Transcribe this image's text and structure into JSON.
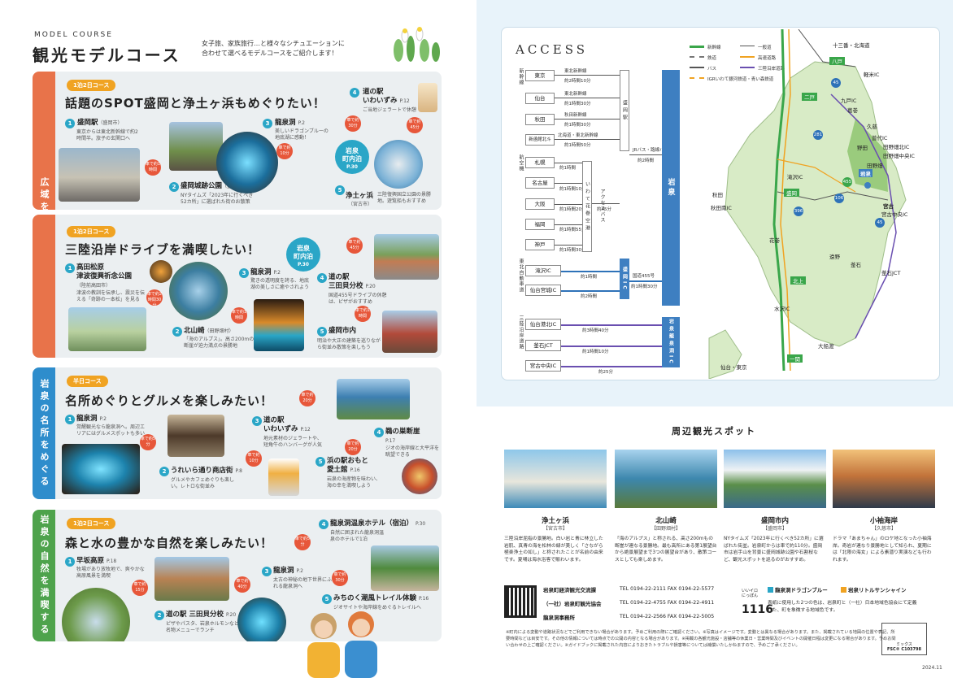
{
  "left": {
    "label": "MODEL COURSE",
    "title": "観光モデルコース",
    "subtitle_1": "女子旅、家族旅行…と様々なシチュエーションに",
    "subtitle_2": "合わせて選べるモデルコースをご紹介します！",
    "sections": [
      {
        "side": "広域をめぐる",
        "tag": "1泊2日コース",
        "heading": "話題のSPOT盛岡と浄土ヶ浜もめぐりたい！",
        "color": "#e8734a",
        "spots": [
          {
            "num": "1",
            "name": "盛岡駅",
            "sub": "（盛岡市）",
            "desc": "東京からは東北新幹線で約2時間半。旅子の玄関口へ"
          },
          {
            "num": "2",
            "name": "盛岡城跡公園",
            "sub": "（盛岡市）",
            "desc": "NYタイムズ「2023年に行くべき52カ所」に選ばれた街のお散策"
          },
          {
            "num": "3",
            "name": "龍泉洞",
            "pg": "P.2",
            "desc": "美しいドラゴンブルーの地底湖に感動！"
          },
          {
            "num": "4",
            "name": "道の駅",
            "name2": "いわいずみ",
            "pg": "P.12",
            "desc": "ご当地ジェラートで休憩"
          },
          {
            "num": "5",
            "name": "浄土ヶ浜",
            "sub": "（宮古市）",
            "desc": "三陸復興国立公園の景勝地。遊覧船もおすすめ"
          }
        ],
        "cars": [
          "車で約1時間",
          "車で約10分",
          "車で約30分",
          "車で約45分",
          "車で約1時間"
        ],
        "stay": [
          "岩泉",
          "町内泊",
          "P.30"
        ]
      },
      {
        "side": "",
        "tag": "1泊2日コース",
        "heading": "三陸沿岸ドライブを満喫したい！",
        "color": "#e8734a",
        "spots": [
          {
            "num": "1",
            "name": "高田松原",
            "name2": "津波復興祈念公園",
            "sub": "（陸前高田市）",
            "desc": "津波の教訓を伝承し、震災を伝える「奇跡の一本松」を見る"
          },
          {
            "num": "2",
            "name": "北山崎",
            "sub": "（田野畑村）",
            "desc": "「海のアルプス」。高さ200mの断崖が迫力満点の景勝地"
          },
          {
            "num": "3",
            "name": "龍泉洞",
            "pg": "P.2",
            "desc": "驚きの透明度を誇る、地底湖の美しさに癒やされよう"
          },
          {
            "num": "4",
            "name": "道の駅",
            "name2": "三田貝分校",
            "pg": "P.20",
            "desc": "国道455号ドライブの休憩は、ピザがおすすめ"
          },
          {
            "num": "5",
            "name": "盛岡市内",
            "desc": "明治や大正の建築を巡りながら街並み散策を楽しもう"
          }
        ],
        "cars": [
          "車で約2時間30分",
          "車で約1時間",
          "車で約45分",
          "車で約1時間"
        ],
        "stay": [
          "岩泉",
          "町内泊",
          "P.30"
        ]
      },
      {
        "side": "岩泉の名所をめぐる",
        "tag": "半日コース",
        "heading": "名所めぐりとグルメを楽しみたい！",
        "color": "#2e8dcc",
        "spots": [
          {
            "num": "1",
            "name": "龍泉洞",
            "pg": "P.2",
            "desc": "覚醒観光なら龍泉洞へ。周辺エリアにはグルメスポットも多い"
          },
          {
            "num": "2",
            "name": "うれいら通り商店街",
            "pg": "P.8",
            "desc": "グルメやカフェめぐりも楽しい。レトロな街並み"
          },
          {
            "num": "3",
            "name": "道の駅",
            "name2": "いわいずみ",
            "pg": "P.12",
            "desc": "地元素材のジェラートや、短角牛のハンバーグが人気"
          },
          {
            "num": "4",
            "name": "鵜の巣断崖",
            "pg": "P.17",
            "desc": "ジオの海岸線と大平洋を眺望できる"
          },
          {
            "num": "5",
            "name": "浜の駅おもと",
            "name2": "愛土館",
            "pg": "P.16",
            "desc": "岩泉の海産物を味わい、海の幸を満喫しよう"
          }
        ],
        "cars": [
          "車で約5分",
          "車で約10分",
          "車で約20分",
          "車で約20分"
        ]
      },
      {
        "side": "岩泉の自然を満喫する",
        "tag": "1泊2日コース",
        "heading": "森と水の豊かな自然を楽しみたい！",
        "color": "#4ea34c",
        "spots": [
          {
            "num": "1",
            "name": "早坂高原",
            "pg": "P.18",
            "desc": "牧場があり放牧地で、爽やかな高原風景を満喫"
          },
          {
            "num": "2",
            "name": "道の駅 三田貝分校",
            "pg": "P.20",
            "desc": "ピザやパスタ、岩泉ホルモンなどの名物メニューでランチ"
          },
          {
            "num": "3",
            "name": "龍泉洞",
            "pg": "P.2",
            "desc": "太古の神秘の地下世界にふれる龍泉洞へ"
          },
          {
            "num": "4",
            "name": "龍泉洞温泉ホテル（宿泊）",
            "pg": "P.30",
            "desc": "自然に囲まれた龍泉洞温泉のホテルで1泊"
          },
          {
            "num": "5",
            "name": "みちのく潮風トレイル体験",
            "pg": "P.16",
            "desc": "ジオサイトや海岸線をめぐるトレイルへ"
          }
        ],
        "cars": [
          "車で約15分",
          "車で約40分",
          "車で約5分",
          "車で約30分"
        ]
      }
    ]
  },
  "right": {
    "access_title": "ACCESS",
    "legend": [
      "新幹線",
      "鉄道",
      "バス",
      "一般道",
      "高速道路",
      "三陸沿岸道路",
      "IGRいわて銀河鉄道・青い森鉄道",
      "三陸鉄道リアス線"
    ],
    "rail_label": "新幹線",
    "air_label": "航空機",
    "exp_label": "東北自動車道",
    "sanriku_label": "三陸沿岸道路",
    "shinkansen": [
      {
        "st": "東京",
        "line": "東北新幹線",
        "time": "約2時間10分"
      },
      {
        "st": "仙台",
        "line": "東北新幹線",
        "time": "約1時間30分"
      },
      {
        "st": "秋田",
        "line": "秋田新幹線",
        "time": "約1時間30分"
      },
      {
        "st": "新函館北斗",
        "line": "北海道・東北新幹線",
        "time": "約1時間50分"
      }
    ],
    "morioka_station": "盛岡駅",
    "bus_label": "JRバス・路線バス",
    "bus_time": "約2時間",
    "air": [
      {
        "st": "札幌",
        "time": "約1時間"
      },
      {
        "st": "名古屋",
        "time": "約1時間10分"
      },
      {
        "st": "大阪",
        "time": "約1時間20分"
      },
      {
        "st": "福岡",
        "time": "約1時間55分"
      },
      {
        "st": "神戸",
        "time": "約1時間30分"
      }
    ],
    "hanamaki": "いわて花巻空港",
    "access_bus": "アクセスバス",
    "access_time": "約45分",
    "iwaizumi": "岩泉",
    "ic": [
      {
        "st": "滝沢IC",
        "time": "約1時間"
      },
      {
        "st": "仙台宮城IC",
        "time": "約2時間"
      }
    ],
    "morioka_ic": "盛岡IC",
    "route455": "国道455号",
    "time455": "約1時間30分",
    "sanriku": [
      {
        "st": "仙台港北IC",
        "time": "約3時間40分"
      },
      {
        "st": "釜石JCT",
        "time": "約1時間10分"
      },
      {
        "st": "宮古中央IC",
        "time": "約25分"
      }
    ],
    "iwaizumi_ryusen": "岩泉龍泉洞IC",
    "map_labels": [
      "十三番・北海道",
      "八戸",
      "一戸",
      "二戸",
      "軽米IC",
      "九戸IC",
      "葛巻",
      "久慈",
      "普代IC",
      "田野畑北IC",
      "田野畑中央IC",
      "野田",
      "宮古",
      "盛岡",
      "花巻",
      "北上",
      "水沢IC",
      "一関",
      "大船渡",
      "釜石",
      "遠野",
      "陸中野田",
      "岩泉",
      "滝沢IC",
      "秋田",
      "秋田南IC",
      "大館",
      "田野畑",
      "小本",
      "宮古中央IC",
      "釜石JCT",
      "仙台・東京"
    ],
    "ichinoseki": "至仙台・東京",
    "nearby_title": "周辺観光スポット",
    "nearby": [
      {
        "name": "浄土ヶ浜",
        "area": "【宮古市】",
        "desc": "三陸沿岸屈指の景勝地。白い岩と青に林立した岩肌、真青の海を松林の緑が美しく「さながら極楽浄土の如し」と称されたことが名前の由来です。夏場は海水浴客で賑わいます。"
      },
      {
        "name": "北山崎",
        "area": "【田野畑村】",
        "desc": "「海のアルプス」と称される、高さ200mもの断崖が連なる景勝地。最も高所にある第1展望台から絶景展望まで3つの展望台があり、散策コースとしても楽しめます。"
      },
      {
        "name": "盛岡市内",
        "area": "【盛岡市】",
        "desc": "NYタイムズ「2023年に行くべき52カ所」に選ばれた街並。岩泉町からは車で約110分。盛岡市は岩手山を背景に盛岡城跡公園や石割桜など、観光スポットを巡るのがおすすめ。"
      },
      {
        "name": "小袖海岸",
        "area": "【久慈市】",
        "desc": "ドラマ「あまちゃん」のロケ地となった小袖海岸。奇岩が連なり景勝地として知られ、夏期には「北限の海女」による素潜り実演なども行われます。"
      }
    ],
    "org1": "岩泉町経済観光交流課",
    "tel1": "TEL 0194-22-2111 FAX 0194-22-5577",
    "org2": "（一社）岩泉町観光協会",
    "tel2": "TEL 0194-22-4755 FAX 0194-22-4911",
    "org3": "龍泉洞事務所",
    "tel3": "TEL 0194-22-2566 FAX 0194-22-5005",
    "brand_small": "いいイロ にっぽん",
    "brand_num": "1116",
    "color1": "龍泉洞ドラゴンブルー",
    "color2": "岩泉リトルサンシャイン",
    "color_desc": "表紙に使用した2つの色は、岩泉町と（一社）日本地域色協会にて定義した、町を象徴する地域色です。",
    "fsc_label": "ミックス",
    "fsc_code": "FSC® C103798",
    "footer": "※町内による変動や道路状況などでご利用できない場合があります。予めご利用の際にご確認ください。※写真はイメージです。変動とは異なる場合があります。また、掲載されている地図の位置や表記、所要時間などは目安です。その他の情報については時点での公開の内容となる場合があります。※掲載の各観光施設・店舗等の休業日・営業時間及びイベントの開催日程は変更になる場合があります。予めお問い合わせの上ご確認ください。※ガイドブックに掲載された内容によりおきたトラブルや損害等については補償いたしかねますので、予めご了承ください。",
    "date": "2024.11"
  }
}
